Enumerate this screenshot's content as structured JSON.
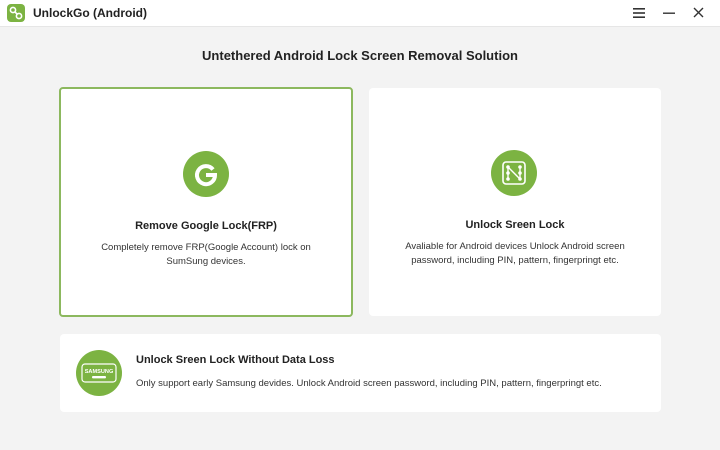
{
  "window": {
    "title": "UnlockGo (Android)",
    "menu_icon": "hamburger-menu-icon",
    "minimize_icon": "minimize-icon",
    "close_icon": "close-icon"
  },
  "main": {
    "title": "Untethered Android Lock Screen Removal Solution"
  },
  "cards": [
    {
      "title": "Remove Google Lock(FRP)",
      "desc_line1": "Completely remove FRP(Google Account) lock on",
      "desc_line2": "SumSung devices.",
      "icon": "google-g-icon",
      "selected": true
    },
    {
      "title": "Unlock Sreen Lock",
      "desc_line1": "Avaliable for Android devices Unlock Android screen",
      "desc_line2": "password, including PIN, pattern, fingerpringt etc.",
      "icon": "pattern-lock-icon",
      "selected": false
    },
    {
      "title": "Unlock Sreen Lock Without Data Loss",
      "desc_line1": "Only support early Samsung devides. Unlock Android screen password, including PIN, pattern, fingerpringt etc.",
      "icon": "samsung-device-icon",
      "icon_text": "SAMSUNG",
      "selected": false
    }
  ],
  "colors": {
    "accent": "#7cb342",
    "selected_border": "#8cb85e",
    "background": "#f3f3f3"
  }
}
